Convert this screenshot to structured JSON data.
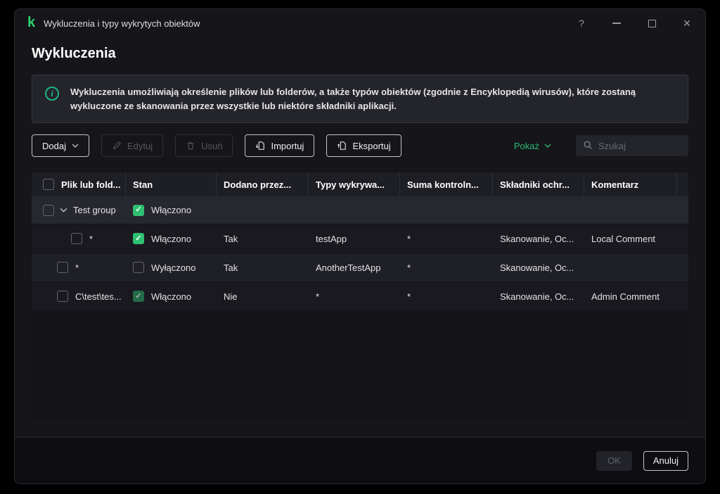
{
  "colors": {
    "accent_green": "#2eb873",
    "checkbox_green": "#2fbf71",
    "logo_green": "#2ad36f"
  },
  "window": {
    "logo_letter": "k",
    "title": "Wykluczenia i typy wykrytych obiektów",
    "controls": {
      "help": "?",
      "close": "✕"
    }
  },
  "page": {
    "title": "Wykluczenia"
  },
  "info_banner": {
    "text": "Wykluczenia umożliwiają określenie plików lub folderów, a także typów obiektów (zgodnie z Encyklopedią wirusów), które zostaną wykluczone ze skanowania przez wszystkie lub niektóre składniki aplikacji."
  },
  "toolbar": {
    "add_label": "Dodaj",
    "edit_label": "Edytuj",
    "delete_label": "Usuń",
    "import_label": "Importuj",
    "export_label": "Eksportuj",
    "show_label": "Pokaż",
    "search_placeholder": "Szukaj"
  },
  "table": {
    "columns": {
      "file": "Plik lub fold...",
      "state": "Stan",
      "added_by": "Dodano przez...",
      "types": "Typy wykrywa...",
      "checksum": "Suma kontroln...",
      "components": "Składniki ochr...",
      "comment": "Komentarz"
    },
    "group": {
      "name": "Test group",
      "state_label": "Włączono",
      "state_checked": true
    },
    "rows": [
      {
        "file": "*",
        "state_label": "Włączono",
        "state_checked": true,
        "added_by": "Tak",
        "types": "testApp",
        "checksum": "*",
        "components": "Skanowanie, Oc...",
        "comment": "Local Comment",
        "locked": false
      },
      {
        "file": "*",
        "state_label": "Wyłączono",
        "state_checked": false,
        "added_by": "Tak",
        "types": "AnotherTestApp",
        "checksum": "*",
        "components": "Skanowanie, Oc...",
        "comment": "",
        "locked": false
      },
      {
        "file": "C\\test\\tes...",
        "state_label": "Włączono",
        "state_checked": true,
        "added_by": "Nie",
        "types": "*",
        "checksum": "*",
        "components": "Skanowanie, Oc...",
        "comment": "Admin Comment",
        "locked": true
      }
    ]
  },
  "footer": {
    "ok_label": "OK",
    "cancel_label": "Anuluj"
  }
}
